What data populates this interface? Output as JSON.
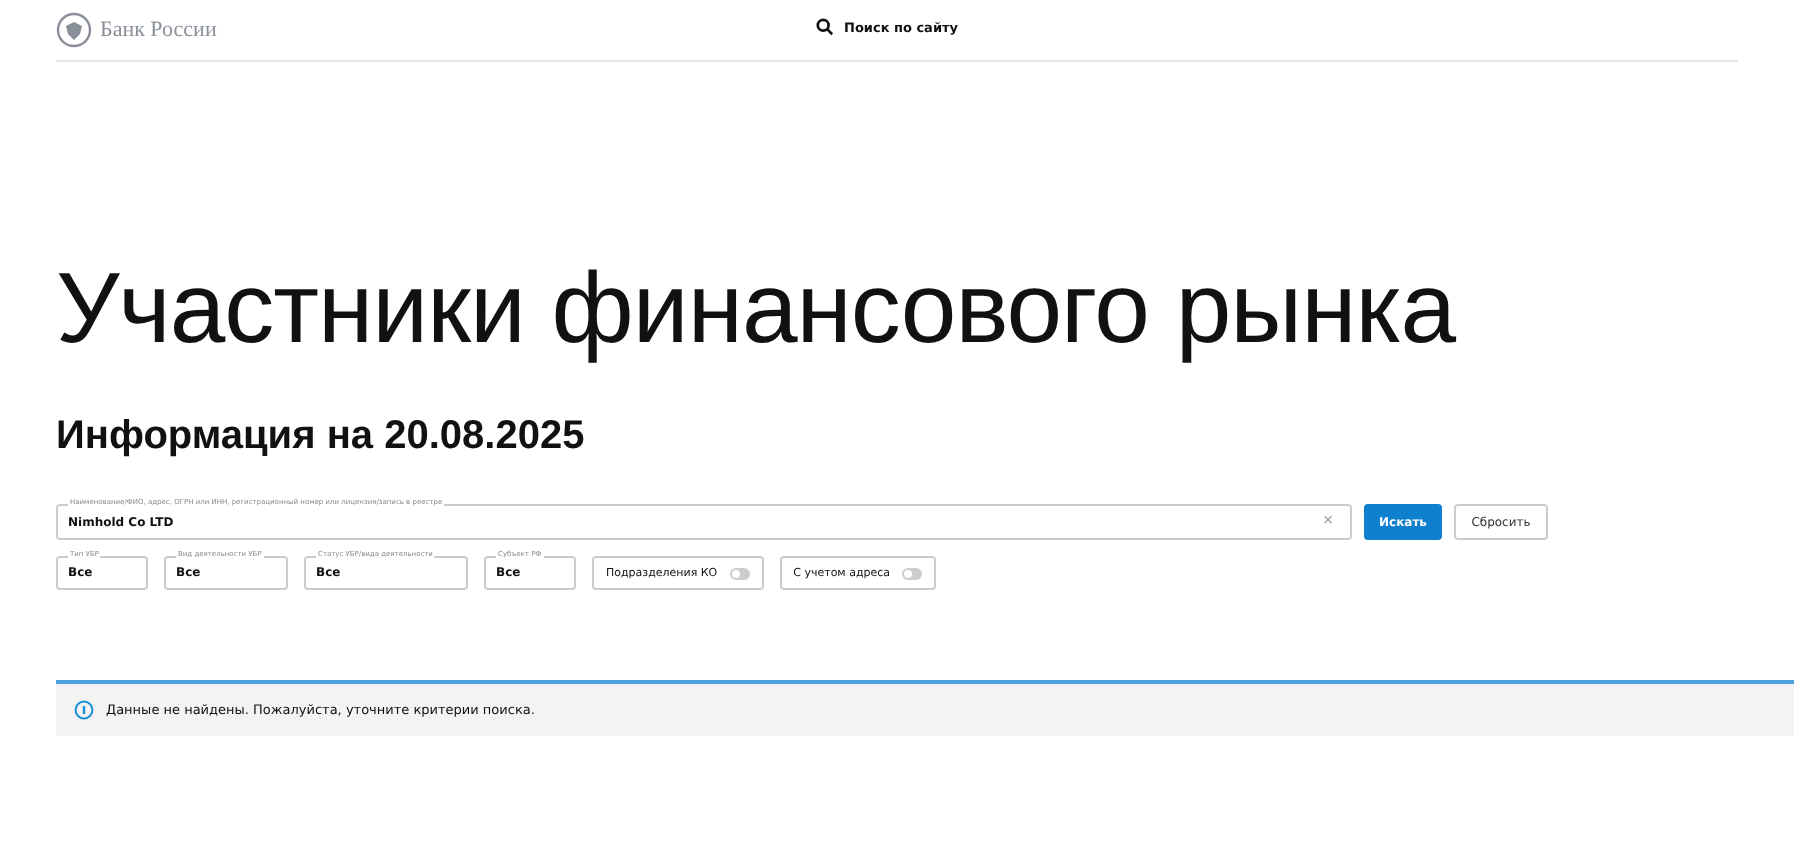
{
  "header": {
    "logo_text": "Банк России",
    "search_label": "Поиск по сайту"
  },
  "title": "Участники финансового рынка",
  "subtitle": "Информация на 20.08.2025",
  "search": {
    "label": "Наименование/ФИО, адрес, ОГРН или ИНН, регистрационный номер или лицензия/запись в реестре",
    "value": "Nimhold Co LTD",
    "clear": "×"
  },
  "buttons": [
    {
      "kind": "primary",
      "label": "Искать"
    },
    {
      "kind": "secondary",
      "label": "Сбросить"
    }
  ],
  "filters": [
    {
      "kind": "select",
      "label": "Тип УБР",
      "value": "Все"
    },
    {
      "kind": "select",
      "label": "Вид деятельности УБР",
      "value": "Все"
    },
    {
      "kind": "select",
      "label": "Статус УБР/вида деятельности",
      "value": "Все"
    },
    {
      "kind": "select",
      "label": "Субъект РФ",
      "value": "Все"
    },
    {
      "kind": "toggle",
      "label": "Подразделения КО",
      "on": false
    },
    {
      "kind": "toggle",
      "label": "С учетом адреса",
      "on": false
    }
  ],
  "message": "Данные не найдены. Пожалуйста, уточните критерии поиска."
}
